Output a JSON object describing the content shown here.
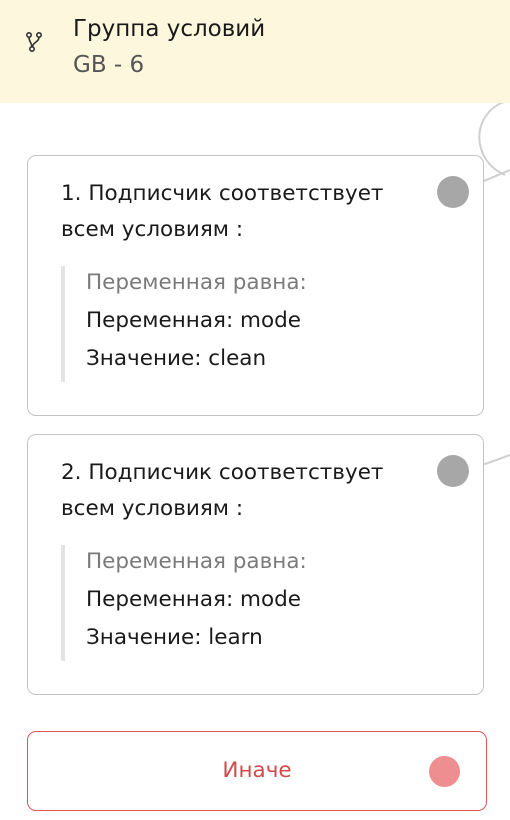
{
  "header": {
    "title": "Группа условий",
    "subtitle": "GB - 6",
    "icon": "branch-icon"
  },
  "cards": [
    {
      "heading": "1. Подписчик соответствует всем условиям :",
      "condition_label": "Переменная равна:",
      "variable_line": "Переменная: mode",
      "value_line": "Значение: clean"
    },
    {
      "heading": "2. Подписчик соответствует всем условиям :",
      "condition_label": "Переменная равна:",
      "variable_line": "Переменная: mode",
      "value_line": "Значение: learn"
    }
  ],
  "else_button": {
    "label": "Иначе"
  },
  "colors": {
    "header_bg": "#fdf7dd",
    "card_border": "#c4c4c4",
    "connector_dot": "#a7a7a7",
    "else_border": "#e0555a",
    "else_text": "#d04a4e",
    "else_dot": "#ef8e90"
  }
}
